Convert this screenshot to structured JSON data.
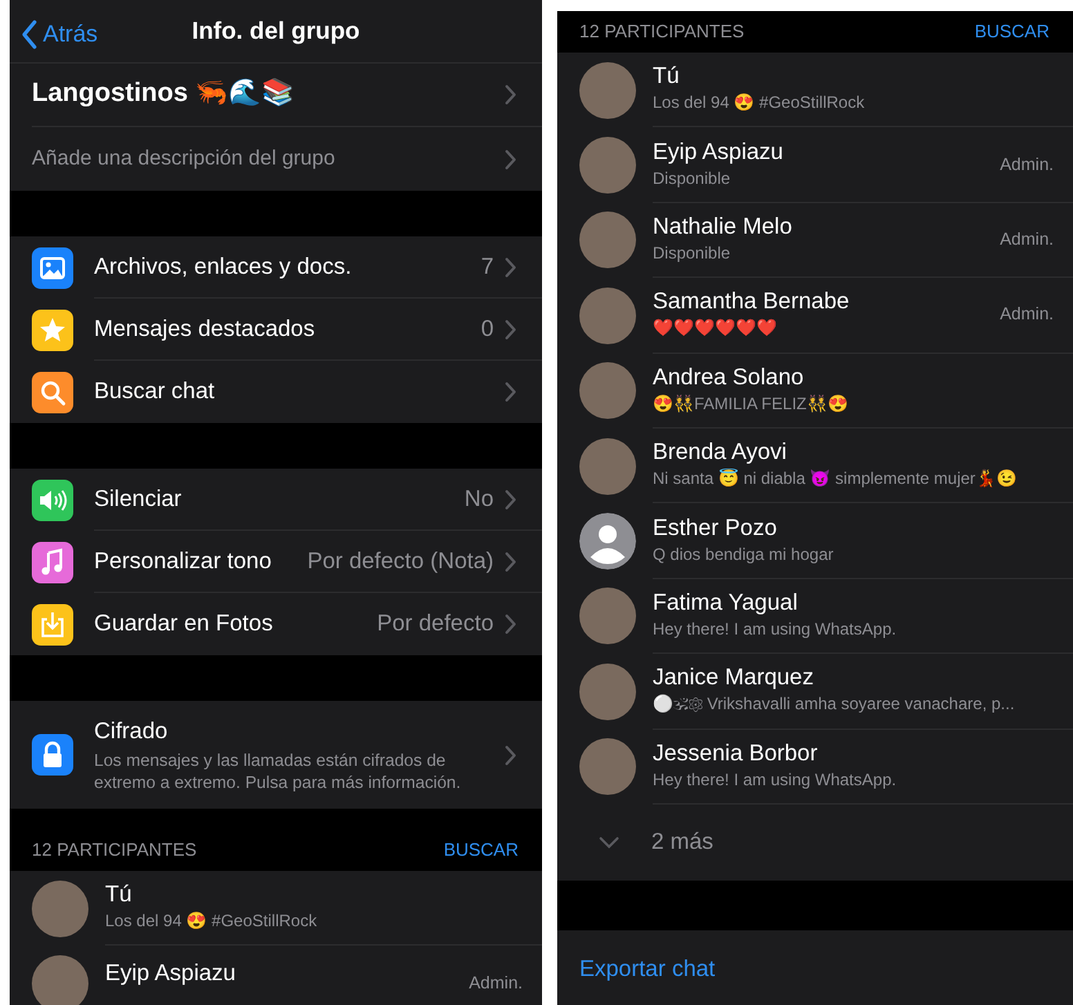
{
  "left_screen": {
    "nav": {
      "back": "Atrás",
      "title": "Info. del grupo"
    },
    "group": {
      "name": "Langostinos 🦐🌊📚",
      "description": "Añade una descripción del grupo"
    },
    "sections": [
      {
        "items": [
          {
            "kind": "media",
            "label": "Archivos, enlaces y docs.",
            "value": "7"
          },
          {
            "kind": "starred",
            "label": "Mensajes destacados",
            "value": "0"
          },
          {
            "kind": "search",
            "label": "Buscar chat"
          }
        ]
      },
      {
        "items": [
          {
            "kind": "mute",
            "label": "Silenciar",
            "value": "No"
          },
          {
            "kind": "tone",
            "label": "Personalizar tono",
            "value": "Por defecto (Nota)"
          },
          {
            "kind": "save",
            "label": "Guardar en Fotos",
            "value": "Por defecto"
          }
        ]
      },
      {
        "items": [
          {
            "kind": "lock",
            "label": "Cifrado",
            "description": "Los mensajes y las llamadas están cifrados de extremo a extremo. Pulsa para más información."
          }
        ]
      }
    ],
    "participants_header": {
      "count": "12 PARTICIPANTES",
      "search": "BUSCAR"
    },
    "participants": [
      {
        "kind": "photo",
        "name": "Tú",
        "status": "Los del 94 😍 #GeoStillRock"
      },
      {
        "kind": "photo",
        "name": "Eyip Aspiazu",
        "role": "Admin."
      }
    ]
  },
  "right_screen": {
    "participants_header": {
      "count": "12 PARTICIPANTES",
      "search": "BUSCAR"
    },
    "participants": [
      {
        "kind": "photo",
        "name": "Tú",
        "status": "Los del 94 😍 #GeoStillRock"
      },
      {
        "kind": "photo",
        "name": "Eyip Aspiazu",
        "status": "Disponible",
        "role": "Admin."
      },
      {
        "kind": "photo",
        "name": "Nathalie Melo",
        "status": "Disponible",
        "role": "Admin."
      },
      {
        "kind": "photo",
        "name": "Samantha Bernabe",
        "status": "❤️❤️❤️❤️❤️❤️",
        "role": "Admin."
      },
      {
        "kind": "photo",
        "name": "Andrea Solano",
        "status": "😍👯FAMILIA FELIZ👯😍"
      },
      {
        "kind": "photo",
        "name": "Brenda Ayovi",
        "status": "Ni santa 😇 ni diabla 😈 simplemente  mujer💃😉"
      },
      {
        "kind": "default",
        "name": "Esther Pozo",
        "status": "Q dios bendiga mi hogar"
      },
      {
        "kind": "photo",
        "name": "Fatima Yagual",
        "status": "Hey there! I am using WhatsApp."
      },
      {
        "kind": "photo",
        "name": "Janice Marquez",
        "status": "⚪🕉⚛ Vrikshavalli amha soyaree vanachare, p..."
      },
      {
        "kind": "photo",
        "name": "Jessenia Borbor",
        "status": "Hey there! I am using WhatsApp."
      }
    ],
    "more": "2 más",
    "export": "Exportar chat"
  }
}
